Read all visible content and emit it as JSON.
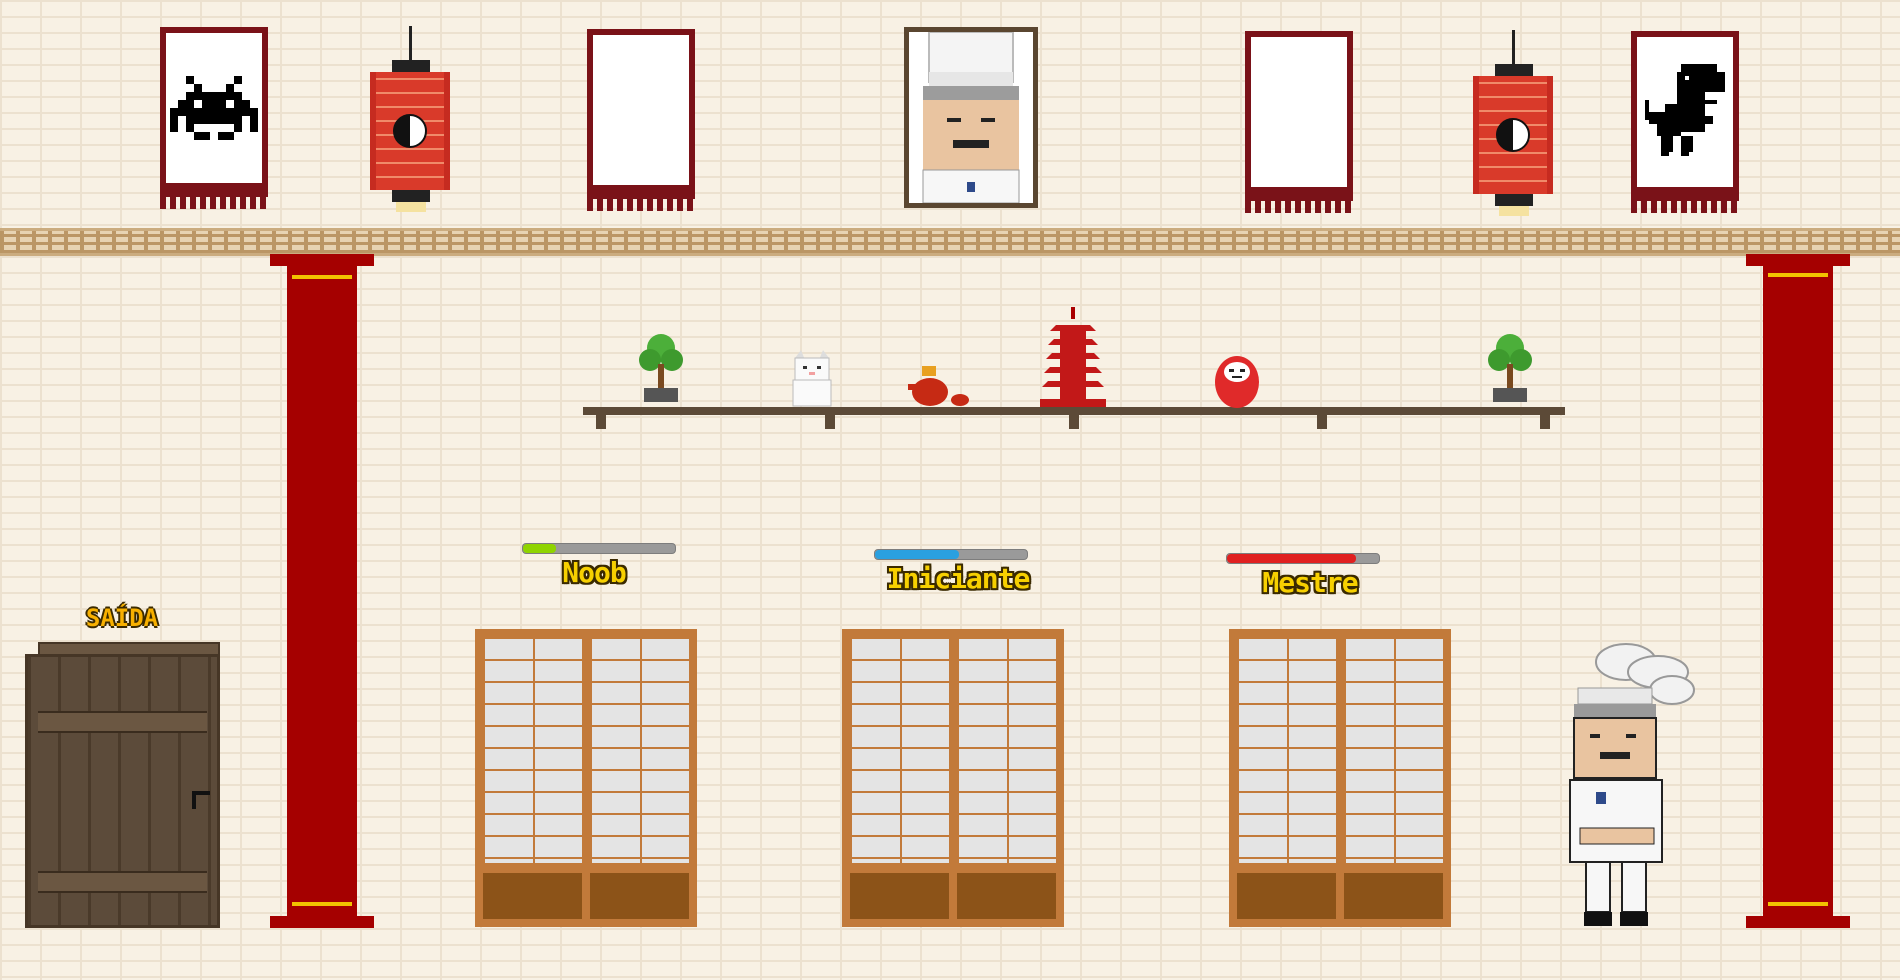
{
  "levels": [
    {
      "label": "Noob",
      "progress": 0.22,
      "color": "#8fd400"
    },
    {
      "label": "Iniciante",
      "progress": 0.55,
      "color": "#2aa0e0"
    },
    {
      "label": "Mestre",
      "progress": 0.85,
      "color": "#e02020"
    }
  ],
  "exit": {
    "label": "SAÍDA"
  },
  "decor": {
    "scrolls": [
      "space-invader-icon",
      "blank",
      "blank",
      "dino-icon"
    ],
    "shelf_items": [
      "bonsai-icon",
      "lucky-cat-icon",
      "teapot-icon",
      "pagoda-icon",
      "daruma-icon",
      "bonsai-icon"
    ]
  },
  "colors": {
    "pillar": "#a50000",
    "lantern": "#d93a2a",
    "label_text": "#f7d000",
    "frame": "#7a1218"
  }
}
